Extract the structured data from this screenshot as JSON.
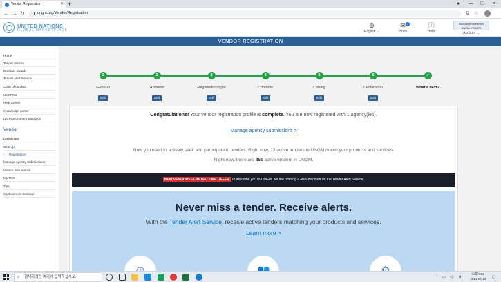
{
  "browser": {
    "tab_title": "Vendor Registration",
    "url": "ungm.org/Vendor/Registration"
  },
  "header": {
    "logo_line1": "UNITED NATIONS",
    "logo_line2": "GLOBAL MARKETPLACE",
    "language_label": "English",
    "inbox_label": "Inbox",
    "inbox_count": "1",
    "help_label": "Help",
    "account_email": "fkaGaa@naver.com",
    "account_id": "UNGM #756679",
    "account_label": "Account"
  },
  "page_title": "VENDOR REGISTRATION",
  "sidebar": {
    "items": [
      "Home",
      "Tender notices",
      "Contract awards",
      "Tender Alert Service",
      "Code of conduct",
      "UNSPSC",
      "Help Center",
      "Knowledge center",
      "UN Procurement Statistics"
    ],
    "vendor_heading": "Vendor",
    "vendor_items": [
      "Dashboard",
      "Settings",
      "Registration",
      "Manage Agency Submissions",
      "Vendor documents",
      "My TAS",
      "Tips",
      "My Business Seminar"
    ]
  },
  "steps": [
    {
      "num": "1",
      "label": "General",
      "edit": "Edit"
    },
    {
      "num": "2",
      "label": "Address",
      "edit": "Edit"
    },
    {
      "num": "3",
      "label": "Registration type",
      "edit": "Edit"
    },
    {
      "num": "4",
      "label": "Contacts",
      "edit": "Edit"
    },
    {
      "num": "5",
      "label": "Coding",
      "edit": "Edit"
    },
    {
      "num": "6",
      "label": "Declaration",
      "edit": "Edit"
    },
    {
      "num": "✓",
      "label": "What's next?",
      "edit": ""
    }
  ],
  "main": {
    "congrats_bold": "Congratulations!",
    "congrats_text1": " Your vendor registration profile is ",
    "congrats_complete": "complete",
    "congrats_text2": ". You are now registered with 1 agency(ies).",
    "manage_link": "Manage agency submissions >",
    "para1": "Now you need to actively seek and participate in tenders. Right now, 12 active tenders in UNGM match your products and services.",
    "para2_a": "Right now, there are ",
    "para2_count": "851",
    "para2_b": " active tenders in UNGM.",
    "banner_tag": "NEW VENDORS - LIMITED TIME OFFER",
    "banner_text": " To welcome you to UNGM, we are offering a 40% discount on the Tender Alert Service.",
    "alert_heading": "Never miss a tender. Receive alerts.",
    "alert_sub_a": "With the ",
    "alert_sub_link": "Tender Alert Service",
    "alert_sub_b": ", receive active tenders matching your products and services.",
    "learn_more": "Learn more >"
  },
  "taskbar": {
    "search_placeholder": "검색하려면 여기에 입력하십시오.",
    "time": "오후 7:51",
    "date": "2021-09-22",
    "lang": "A"
  }
}
